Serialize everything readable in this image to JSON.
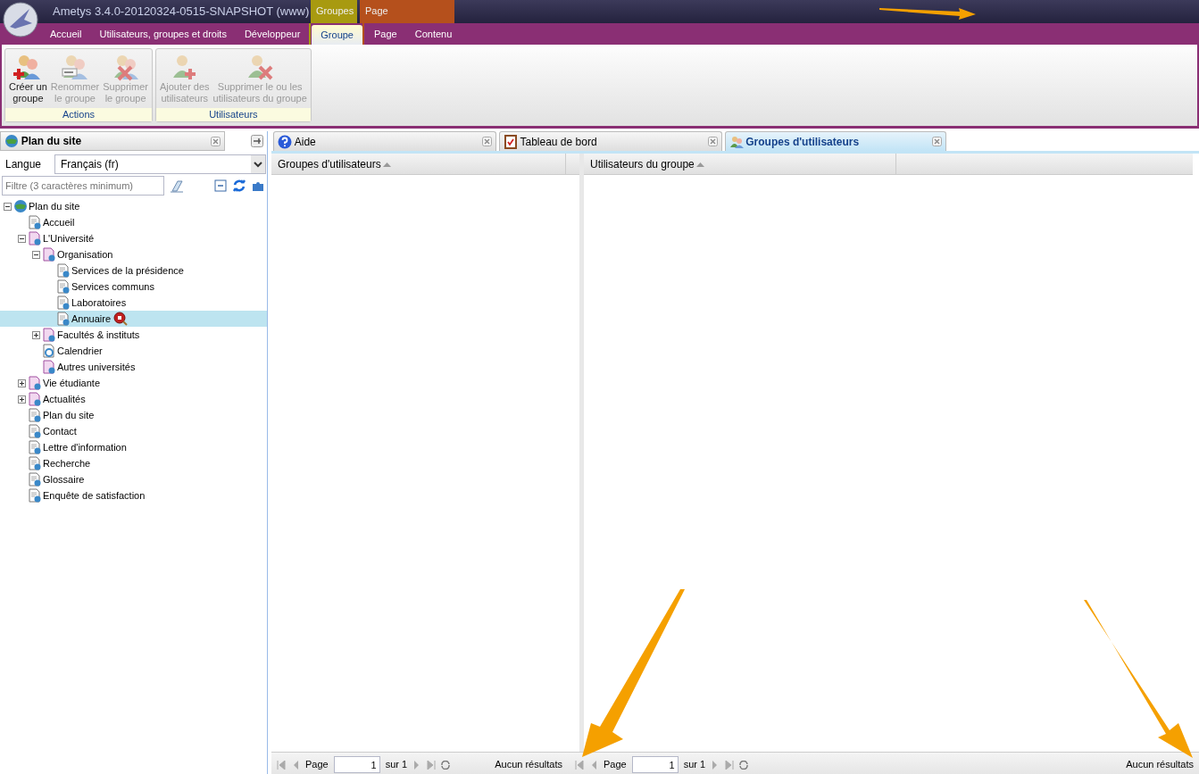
{
  "app": {
    "title": "Ametys 3.4.0-20120324-0515-SNAPSHOT (www)"
  },
  "context_groups": [
    {
      "label": "Groupes",
      "color": "#a89a10",
      "tabs": [
        {
          "label": "Groupe",
          "selected": true
        }
      ]
    },
    {
      "label": "Page",
      "color": "#b5501c",
      "tabs": [
        {
          "label": "Page",
          "selected": false
        },
        {
          "label": "Contenu",
          "selected": false
        }
      ]
    }
  ],
  "ribbon_tabs": [
    {
      "label": "Accueil",
      "selected": false
    },
    {
      "label": "Utilisateurs, groupes et droits",
      "selected": false
    },
    {
      "label": "Développeur",
      "selected": false
    }
  ],
  "ribbon_groups": [
    {
      "title": "Actions",
      "buttons": [
        {
          "lines": [
            "Créer un",
            "groupe"
          ],
          "kind": "add",
          "disabled": false
        },
        {
          "lines": [
            "Renommer",
            "le groupe"
          ],
          "kind": "rename",
          "disabled": true
        },
        {
          "lines": [
            "Supprimer",
            "le groupe"
          ],
          "kind": "delete",
          "disabled": true
        }
      ]
    },
    {
      "title": "Utilisateurs",
      "buttons": [
        {
          "lines": [
            "Ajouter des",
            "utilisateurs"
          ],
          "kind": "add-user",
          "disabled": true
        },
        {
          "lines": [
            "Supprimer le ou les",
            "utilisateurs du groupe"
          ],
          "kind": "remove-user",
          "disabled": true
        }
      ]
    }
  ],
  "sitemap": {
    "title": "Plan du site",
    "language_label": "Langue",
    "language": "Français (fr)",
    "filter_placeholder": "Filtre (3 caractères minimum)",
    "tree": [
      {
        "label": "Plan du site",
        "kind": "site",
        "expanded": true,
        "selected": false,
        "children": [
          {
            "label": "Accueil",
            "kind": "page",
            "selected": false
          },
          {
            "label": "L'Université",
            "kind": "section",
            "expanded": true,
            "selected": false,
            "children": [
              {
                "label": "Organisation",
                "kind": "section",
                "expanded": true,
                "selected": false,
                "children": [
                  {
                    "label": "Services de la présidence",
                    "kind": "page",
                    "selected": false,
                    "restricted": false
                  },
                  {
                    "label": "Services communs",
                    "kind": "page",
                    "selected": false,
                    "restricted": false
                  },
                  {
                    "label": "Laboratoires",
                    "kind": "page",
                    "selected": false,
                    "restricted": false
                  },
                  {
                    "label": "Annuaire",
                    "kind": "page",
                    "selected": true,
                    "restricted": true
                  }
                ]
              },
              {
                "label": "Facultés & instituts",
                "kind": "section",
                "expanded": false,
                "selected": false
              },
              {
                "label": "Calendrier",
                "kind": "calendar",
                "selected": false
              },
              {
                "label": "Autres universités",
                "kind": "section",
                "selected": false
              }
            ]
          },
          {
            "label": "Vie étudiante",
            "kind": "section",
            "expanded": false,
            "selected": false
          },
          {
            "label": "Actualités",
            "kind": "section",
            "expanded": false,
            "selected": false
          },
          {
            "label": "Plan du site",
            "kind": "page",
            "selected": false
          },
          {
            "label": "Contact",
            "kind": "page",
            "selected": false
          },
          {
            "label": "Lettre d'information",
            "kind": "page",
            "selected": false
          },
          {
            "label": "Recherche",
            "kind": "page",
            "selected": false
          },
          {
            "label": "Glossaire",
            "kind": "page",
            "selected": false
          },
          {
            "label": "Enquête de satisfaction",
            "kind": "page",
            "selected": false
          }
        ]
      }
    ]
  },
  "tabs": [
    {
      "label": "Aide",
      "kind": "help",
      "selected": false
    },
    {
      "label": "Tableau de bord",
      "kind": "dashboard",
      "selected": false
    },
    {
      "label": "Groupes d'utilisateurs",
      "kind": "groups",
      "selected": true
    }
  ],
  "grids": [
    {
      "column": "Groupes d'utilisateurs",
      "pager": {
        "page_label": "Page",
        "page": "1",
        "of": "sur 1",
        "status": "Aucun résultats"
      }
    },
    {
      "column": "Utilisateurs du groupe",
      "pager": {
        "page_label": "Page",
        "page": "1",
        "of": "sur 1",
        "status": "Aucun résultats"
      }
    }
  ]
}
